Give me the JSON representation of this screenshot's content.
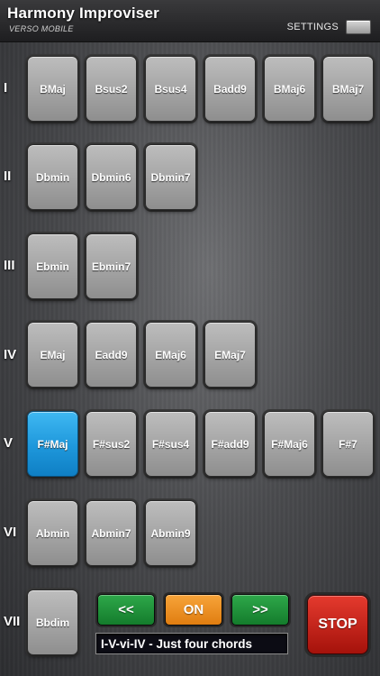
{
  "header": {
    "title": "Harmony Improviser",
    "subtitle": "VERSO MOBILE",
    "settings_label": "SETTINGS",
    "settings_icon": "settings-toggle-icon"
  },
  "rows": [
    {
      "numeral": "I",
      "chords": [
        "BMaj",
        "Bsus2",
        "Bsus4",
        "Badd9",
        "BMaj6",
        "BMaj7"
      ]
    },
    {
      "numeral": "II",
      "chords": [
        "Dbmin",
        "Dbmin6",
        "Dbmin7"
      ]
    },
    {
      "numeral": "III",
      "chords": [
        "Ebmin",
        "Ebmin7"
      ]
    },
    {
      "numeral": "IV",
      "chords": [
        "EMaj",
        "Eadd9",
        "EMaj6",
        "EMaj7"
      ]
    },
    {
      "numeral": "V",
      "chords": [
        "F#Maj",
        "F#sus2",
        "F#sus4",
        "F#add9",
        "F#Maj6",
        "F#7"
      ],
      "active_chord": "F#Maj"
    },
    {
      "numeral": "VI",
      "chords": [
        "Abmin",
        "Abmin7",
        "Abmin9"
      ]
    },
    {
      "numeral": "VII",
      "chords": [
        "Bbdim"
      ]
    }
  ],
  "controls": {
    "prev_label": "<<",
    "on_label": "ON",
    "next_label": ">>",
    "progression_display": "I-V-vi-IV - Just four chords",
    "stop_label": "STOP"
  },
  "colors": {
    "active_chord": "#1e97db",
    "nav_green": "#1f8f39",
    "on_orange": "#f39a2a",
    "stop_red": "#c41f15"
  }
}
